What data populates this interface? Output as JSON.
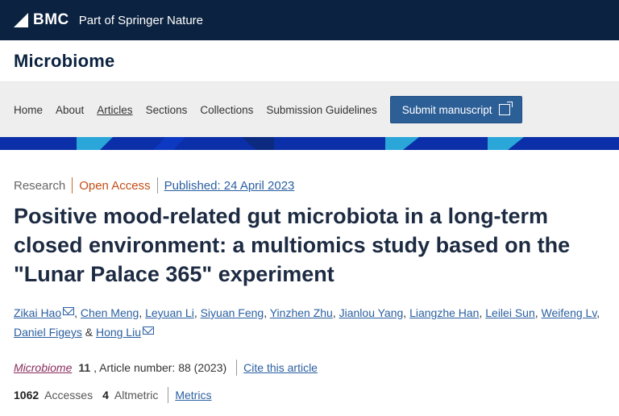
{
  "header": {
    "brand": "BMC",
    "tagline": "Part of Springer Nature",
    "colors": {
      "dark": "#0b2240",
      "band": "#0a2fa8"
    }
  },
  "journal": {
    "title": "Microbiome"
  },
  "nav": {
    "items": [
      {
        "label": "Home"
      },
      {
        "label": "About"
      },
      {
        "label": "Articles"
      },
      {
        "label": "Sections"
      },
      {
        "label": "Collections"
      },
      {
        "label": "Submission Guidelines"
      }
    ],
    "submit_label": "Submit manuscript",
    "submit_icon": "external-link-icon"
  },
  "article": {
    "type": "Research",
    "access": "Open Access",
    "published": "Published: 24 April 2023",
    "title": "Positive mood-related gut microbiota in a long-term closed environment: a multiomics study based on the \"Lunar Palace 365\" experiment",
    "authors": [
      "Zikai Hao",
      "Chen Meng",
      "Leyuan Li",
      "Siyuan Feng",
      "Yinzhen Zhu",
      "Jianlou Yang",
      "Liangzhe Han",
      "Leilei Sun",
      "Weifeng Lv",
      "Daniel Figeys",
      "Hong Liu"
    ],
    "ampersand": "&",
    "citation": {
      "journal": "Microbiome",
      "volume": "11",
      "article_number": ", Article number: 88 (2023)",
      "cite_label": "Cite this article"
    },
    "metrics": {
      "accesses": "1062",
      "accesses_label": "Accesses",
      "altmetric": "4",
      "altmetric_label": "Altmetric",
      "metrics_link": "Metrics"
    }
  }
}
